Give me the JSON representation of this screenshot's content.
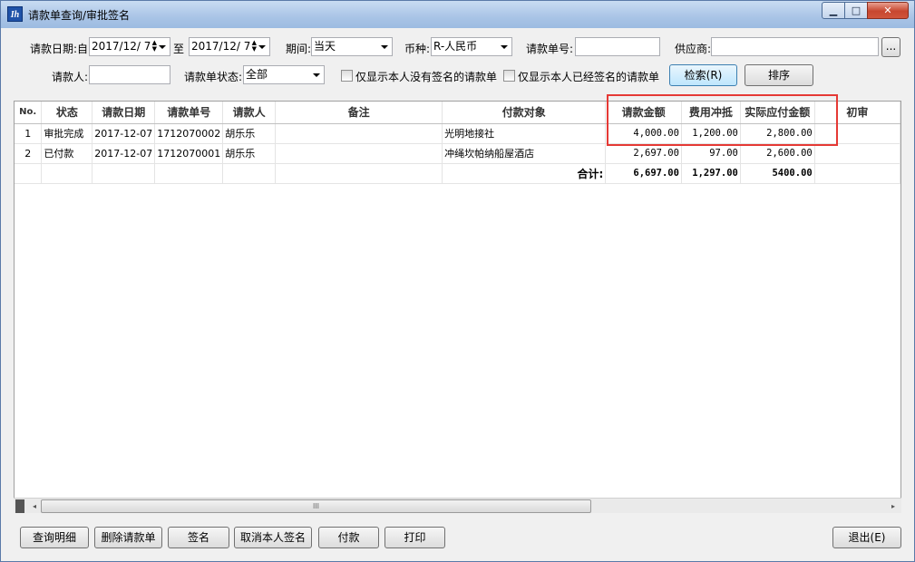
{
  "window": {
    "title": "请款单查询/审批签名",
    "min_glyph": "▁",
    "max_glyph": "□",
    "close_glyph": "✕"
  },
  "filters": {
    "date_label": "请款日期:自",
    "date_from": "2017/12/ 7",
    "to_label": "至",
    "date_to": "2017/12/ 7",
    "period_label": "期间:",
    "period_value": "当天",
    "currency_label": "币种:",
    "currency_value": "R-人民币",
    "number_label": "请款单号:",
    "number_value": "",
    "supplier_label": "供应商:",
    "supplier_value": "",
    "browse_label": "...",
    "applicant_label": "请款人:",
    "applicant_value": "",
    "status_label": "请款单状态:",
    "status_value": "全部",
    "only_unsigned_label": "仅显示本人没有签名的请款单",
    "only_signed_label": "仅显示本人已经签名的请款单",
    "search_button": "检索(R)",
    "sort_button": "排序"
  },
  "table": {
    "columns": [
      "No.",
      "状态",
      "请款日期",
      "请款单号",
      "请款人",
      "备注",
      "付款对象",
      "请款金额",
      "费用冲抵",
      "实际应付金额",
      "初审"
    ],
    "rows": [
      {
        "no": "1",
        "status": "审批完成",
        "date": "2017-12-07",
        "number": "1712070002",
        "applicant": "胡乐乐",
        "note": "",
        "payee": "光明地接社",
        "amount": "4,000.00",
        "offset": "1,200.00",
        "actual": "2,800.00",
        "first_review": ""
      },
      {
        "no": "2",
        "status": "已付款",
        "date": "2017-12-07",
        "number": "1712070001",
        "applicant": "胡乐乐",
        "note": "",
        "payee": "冲绳坎帕纳船屋酒店",
        "amount": "2,697.00",
        "offset": "97.00",
        "actual": "2,600.00",
        "first_review": ""
      }
    ],
    "totals": {
      "label": "合计:",
      "amount": "6,697.00",
      "offset": "1,297.00",
      "actual": "5400.00"
    }
  },
  "scrollbar": {
    "grip": "III",
    "left_arrow": "◂",
    "right_arrow": "▸"
  },
  "actions": {
    "detail": "查询明细",
    "delete": "删除请款单",
    "sign": "签名",
    "cancel_sign": "取消本人签名",
    "pay": "付款",
    "print": "打印",
    "exit": "退出(E)"
  },
  "colors": {
    "highlight": "#e53935",
    "title_bar": "#a9c4e6"
  }
}
